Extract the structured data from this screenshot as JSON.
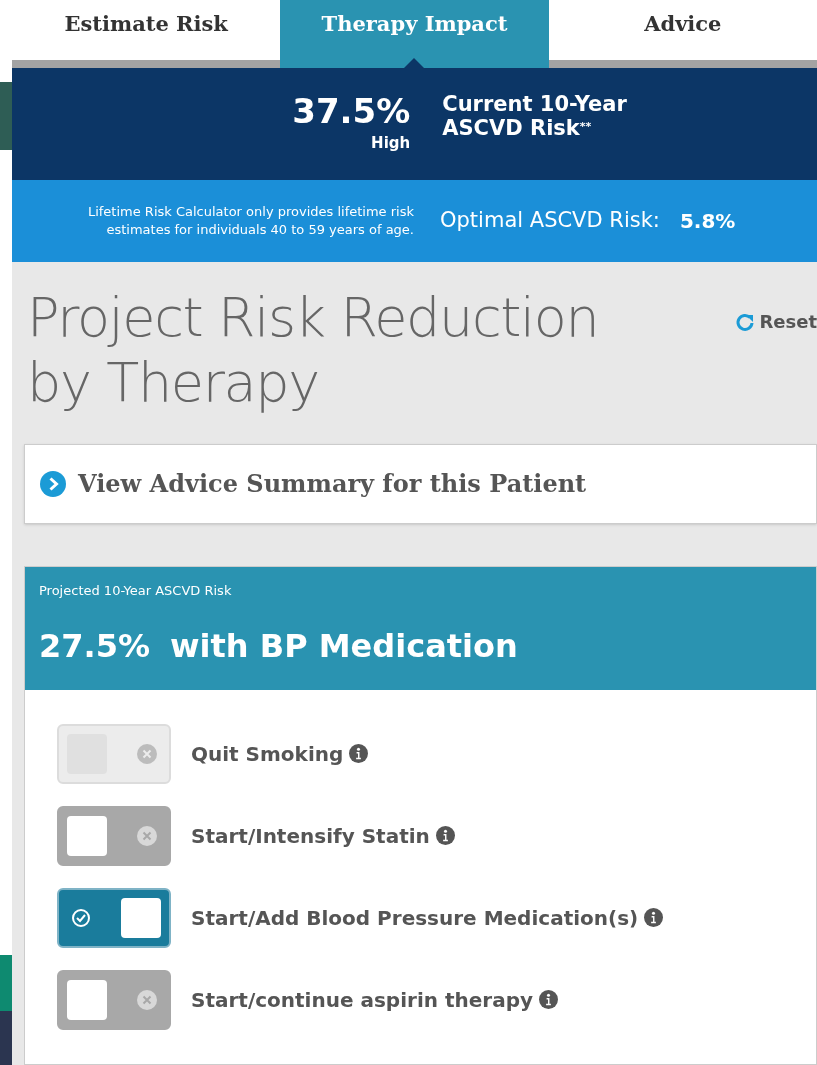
{
  "tabs": [
    {
      "label": "Estimate Risk",
      "selected": false
    },
    {
      "label": "Therapy Impact",
      "selected": true
    },
    {
      "label": "Advice",
      "selected": false
    }
  ],
  "current_risk": {
    "value": "37.5%",
    "category": "High",
    "label": "Current 10-Year",
    "label_line_2": "ASCVD Risk",
    "footnote": "**"
  },
  "lifetime_note": {
    "line_1": "Lifetime Risk Calculator only provides lifetime risk",
    "line_2": "estimates for individuals 40 to 59 years of age."
  },
  "optimal_risk": {
    "label": "Optimal ASCVD Risk:",
    "value": "5.8%"
  },
  "title": "Project Risk Reduction by Therapy",
  "reset_link": "Reset",
  "advice_link": "View Advice Summary for this Patient",
  "projection": {
    "caption": "Projected 10-Year ASCVD Risk",
    "value": "27.5%",
    "label": "with BP Medication"
  },
  "therapies": [
    {
      "label": "Quit Smoking",
      "on": false,
      "disabled": true
    },
    {
      "label": "Start/Intensify Statin",
      "on": false,
      "disabled": false
    },
    {
      "label": "Start/Add Blood Pressure Medication(s)",
      "on": true,
      "disabled": false
    },
    {
      "label": "Start/continue aspirin therapy",
      "on": false,
      "disabled": false
    }
  ]
}
